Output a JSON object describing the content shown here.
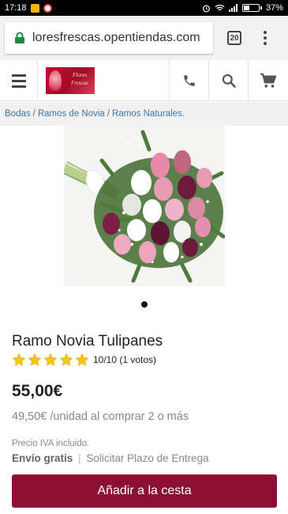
{
  "status_bar": {
    "time": "17:18",
    "battery_level": 0.37,
    "battery_text": "37%"
  },
  "browser": {
    "url": "loresfrescas.opentiendas.com",
    "tab_count": "20"
  },
  "header": {
    "logo_text": "Flores Frescas",
    "icons": [
      "menu-icon",
      "phone-icon",
      "search-icon",
      "cart-icon"
    ]
  },
  "breadcrumb": {
    "items": [
      "Bodas",
      "Ramos de Novia",
      "Ramos Naturales."
    ]
  },
  "carousel": {
    "active_index": 0,
    "total": 1
  },
  "product": {
    "title": "Ramo Novia Tulipanes",
    "rating_value": 5,
    "rating_max": 5,
    "rating_score": "10/10",
    "rating_votes": "(1 votos)",
    "price": "55,00€",
    "quantity_price": "49,50€ /unidad al comprar 2 o más",
    "vat_note": "Precio IVA incluido.",
    "shipping_free": "Envío gratis",
    "shipping_separator": "|",
    "delivery_link": "Solicitar Plazo de Entrega",
    "add_to_cart": "Añadir a la cesta"
  },
  "colors": {
    "accent": "#8c0f34",
    "link": "#3d77a8",
    "star": "#f5c518",
    "lock": "#1e8e3e"
  }
}
